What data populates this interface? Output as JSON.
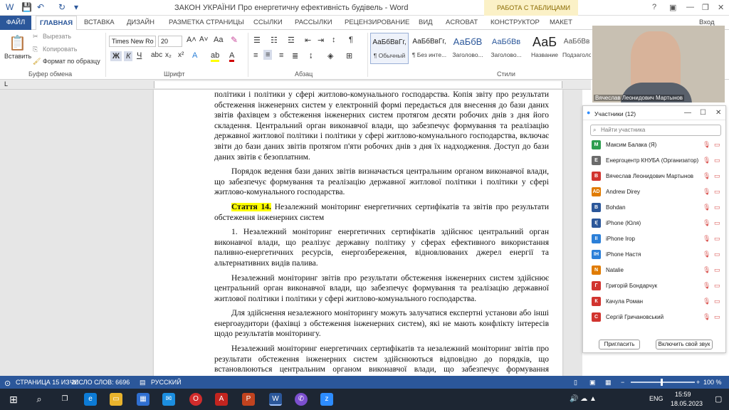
{
  "title_bar": {
    "doc_title": "ЗАКОН УКРАЇНИ Про енергетичну ефективність будівель - Word",
    "tools_group": "РАБОТА С ТАБЛИЦАМИ",
    "login": "Вход"
  },
  "tabs": {
    "file": "ФАЙЛ",
    "home": "ГЛАВНАЯ",
    "items": [
      "ВСТАВКА",
      "ДИЗАЙН",
      "РАЗМЕТКА СТРАНИЦЫ",
      "ССЫЛКИ",
      "РАССЫЛКИ",
      "РЕЦЕНЗИРОВАНИЕ",
      "ВИД",
      "ACROBAT",
      "КОНСТРУКТОР",
      "МАКЕТ"
    ]
  },
  "ribbon": {
    "clipboard": {
      "paste": "Вставить",
      "cut": "Вырезать",
      "copy": "Копировать",
      "format_painter": "Формат по образцу",
      "label": "Буфер обмена"
    },
    "font": {
      "name": "Times New Ro",
      "size": "20",
      "label": "Шрифт"
    },
    "paragraph": {
      "label": "Абзац"
    },
    "styles": {
      "label": "Стили",
      "cards": [
        {
          "preview": "АаБбВвГг,",
          "name": "¶ Обычный"
        },
        {
          "preview": "АаБбВвГг,",
          "name": "¶ Без инте..."
        },
        {
          "preview": "АаБбВ",
          "name": "Заголово..."
        },
        {
          "preview": "АаБбВв",
          "name": "Заголово..."
        },
        {
          "preview": "АаБ",
          "name": "Название"
        },
        {
          "preview": "АаБбВв",
          "name": "Подзаголо..."
        }
      ]
    }
  },
  "document": {
    "p1": "політики і політики у сфері житлово-комунального господарства. Копія звіту про результати обстеження інженерних систем у електронній формі передається для внесення до бази даних звітів фахівцем з обстеження інженерних систем протягом десяти робочих днів з дня його складення. Центральний орган виконавчої влади, що забезпечує формування та реалізацію державної житлової політики і політики у сфері житлово-комунального господарства, включає звіти до бази даних звітів протягом п'яти робочих днів з дня їх надходження. Доступ до бази даних звітів є безоплатним.",
    "p2": "Порядок ведення бази даних звітів визначається центральним органом виконавчої влади, що забезпечує формування та реалізацію державної житлової політики і політики у сфері житлово-комунального господарства.",
    "article_label": "Стаття 14.",
    "article_title": " Незалежний моніторинг енергетичних сертифікатів та звітів про результати обстеження інженерних систем",
    "p3": "1. Незалежний моніторинг енергетичних сертифікатів здійснює центральний орган виконавчої влади, що реалізує державну політику у сферах ефективного використання паливно-енергетичних ресурсів, енергозбереження, відновлюваних джерел енергії та альтернативних видів палива.",
    "p4": "Незалежний моніторинг звітів про результати обстеження інженерних систем здійснює центральний орган виконавчої влади, що забезпечує формування та реалізацію державної житлової політики і політики у сфері житлово-комунального господарства.",
    "p5": "Для здійснення незалежного моніторингу можуть залучатися експертні установи або інші енергоаудитори (фахівці з обстеження інженерних систем), які не мають конфлікту інтересів щодо результатів моніторингу.",
    "p6": "Незалежний моніторинг енергетичних сертифікатів та незалежний моніторинг звітів про результати обстеження інженерних систем здійснюються відповідно до порядків, що встановлюються центральним органом виконавчої влади, що забезпечує формування державної житлової політики і політики у сферах житлово-комунального господарства"
  },
  "status_bar": {
    "page": "СТРАНИЦА 15 ИЗ 20",
    "words": "ЧИСЛО СЛОВ: 6696",
    "lang": "РУССКИЙ",
    "zoom": "100 %"
  },
  "taskbar": {
    "time": "15:59",
    "date": "18.05.2023",
    "lang": "ENG"
  },
  "video": {
    "name": "Вячеслав Леонидович Мартынов"
  },
  "participants": {
    "title": "Участники (12)",
    "search_placeholder": "Найти участника",
    "invite": "Пригласить",
    "unmute_me": "Включить свой звук",
    "list": [
      {
        "initials": "М",
        "name": "Максим Балака (Я)",
        "color": "#2e9e4f"
      },
      {
        "initials": "Е",
        "name": "Енергоцентр КНУБА (Организатор)",
        "color": "#6b6b6b"
      },
      {
        "initials": "В",
        "name": "Вячеслав Леонидович Мартынов",
        "color": "#d1342f"
      },
      {
        "initials": "AD",
        "name": "Andrew Direy",
        "color": "#e07b00"
      },
      {
        "initials": "B",
        "name": "Bohdan",
        "color": "#2b579a"
      },
      {
        "initials": "I(",
        "name": "iPhone (Юля)",
        "color": "#2b579a"
      },
      {
        "initials": "II",
        "name": "iPhone Irop",
        "color": "#2b7fd8"
      },
      {
        "initials": "IH",
        "name": "iPhone Настя",
        "color": "#2b7fd8"
      },
      {
        "initials": "N",
        "name": "Natalie",
        "color": "#e07b00"
      },
      {
        "initials": "Г",
        "name": "Григорій Бондарчук",
        "color": "#d1342f"
      },
      {
        "initials": "К",
        "name": "Качула Роман",
        "color": "#d1342f"
      },
      {
        "initials": "С",
        "name": "Сергій Гричановський",
        "color": "#d1342f"
      }
    ]
  }
}
